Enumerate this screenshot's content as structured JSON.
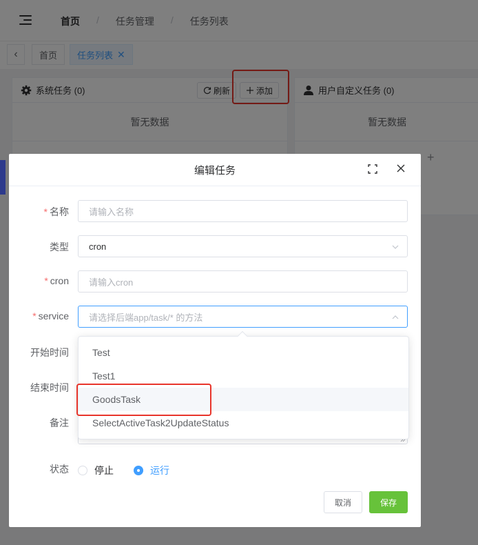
{
  "breadcrumb": {
    "home": "首页",
    "sep": "/",
    "level2": "任务管理",
    "level3": "任务列表"
  },
  "tags": {
    "home": "首页",
    "active": "任务列表",
    "close_glyph": "✕",
    "back_glyph": "‹"
  },
  "system_panel": {
    "title": "系统任务 (0)",
    "refresh_label": "刷新",
    "add_label": "添加",
    "empty_text": "暂无数据"
  },
  "user_panel": {
    "title": "用户自定义任务 (0)",
    "empty_text": "暂无数据",
    "add_glyph": "+"
  },
  "dialog": {
    "title": "编辑任务",
    "fields": {
      "name": {
        "label": "名称",
        "required": "*",
        "placeholder": "请输入名称"
      },
      "type": {
        "label": "类型",
        "value": "cron"
      },
      "cron": {
        "label": "cron",
        "required": "*",
        "placeholder": "请输入cron"
      },
      "service": {
        "label": "service",
        "required": "*",
        "placeholder": "请选择后端app/task/* 的方法"
      },
      "start_time": {
        "label": "开始时间"
      },
      "end_time": {
        "label": "结束时间"
      },
      "remark": {
        "label": "备注"
      },
      "status": {
        "label": "状态",
        "options": [
          "停止",
          "运行"
        ],
        "selected": "运行"
      }
    },
    "service_options": [
      "Test",
      "Test1",
      "GoodsTask",
      "SelectActiveTask2UpdateStatus"
    ],
    "highlighted_option": "GoodsTask",
    "cancel_label": "取消",
    "save_label": "保存"
  },
  "colors": {
    "primary": "#409eff",
    "save": "#67c23a",
    "annotation": "#e8352b",
    "required": "#f56c6c"
  },
  "icons": [
    "menu-icon",
    "gear-icon",
    "refresh-icon",
    "plus-icon",
    "user-icon",
    "fullscreen-icon",
    "close-icon",
    "chevron-down-icon",
    "chevron-up-icon"
  ]
}
